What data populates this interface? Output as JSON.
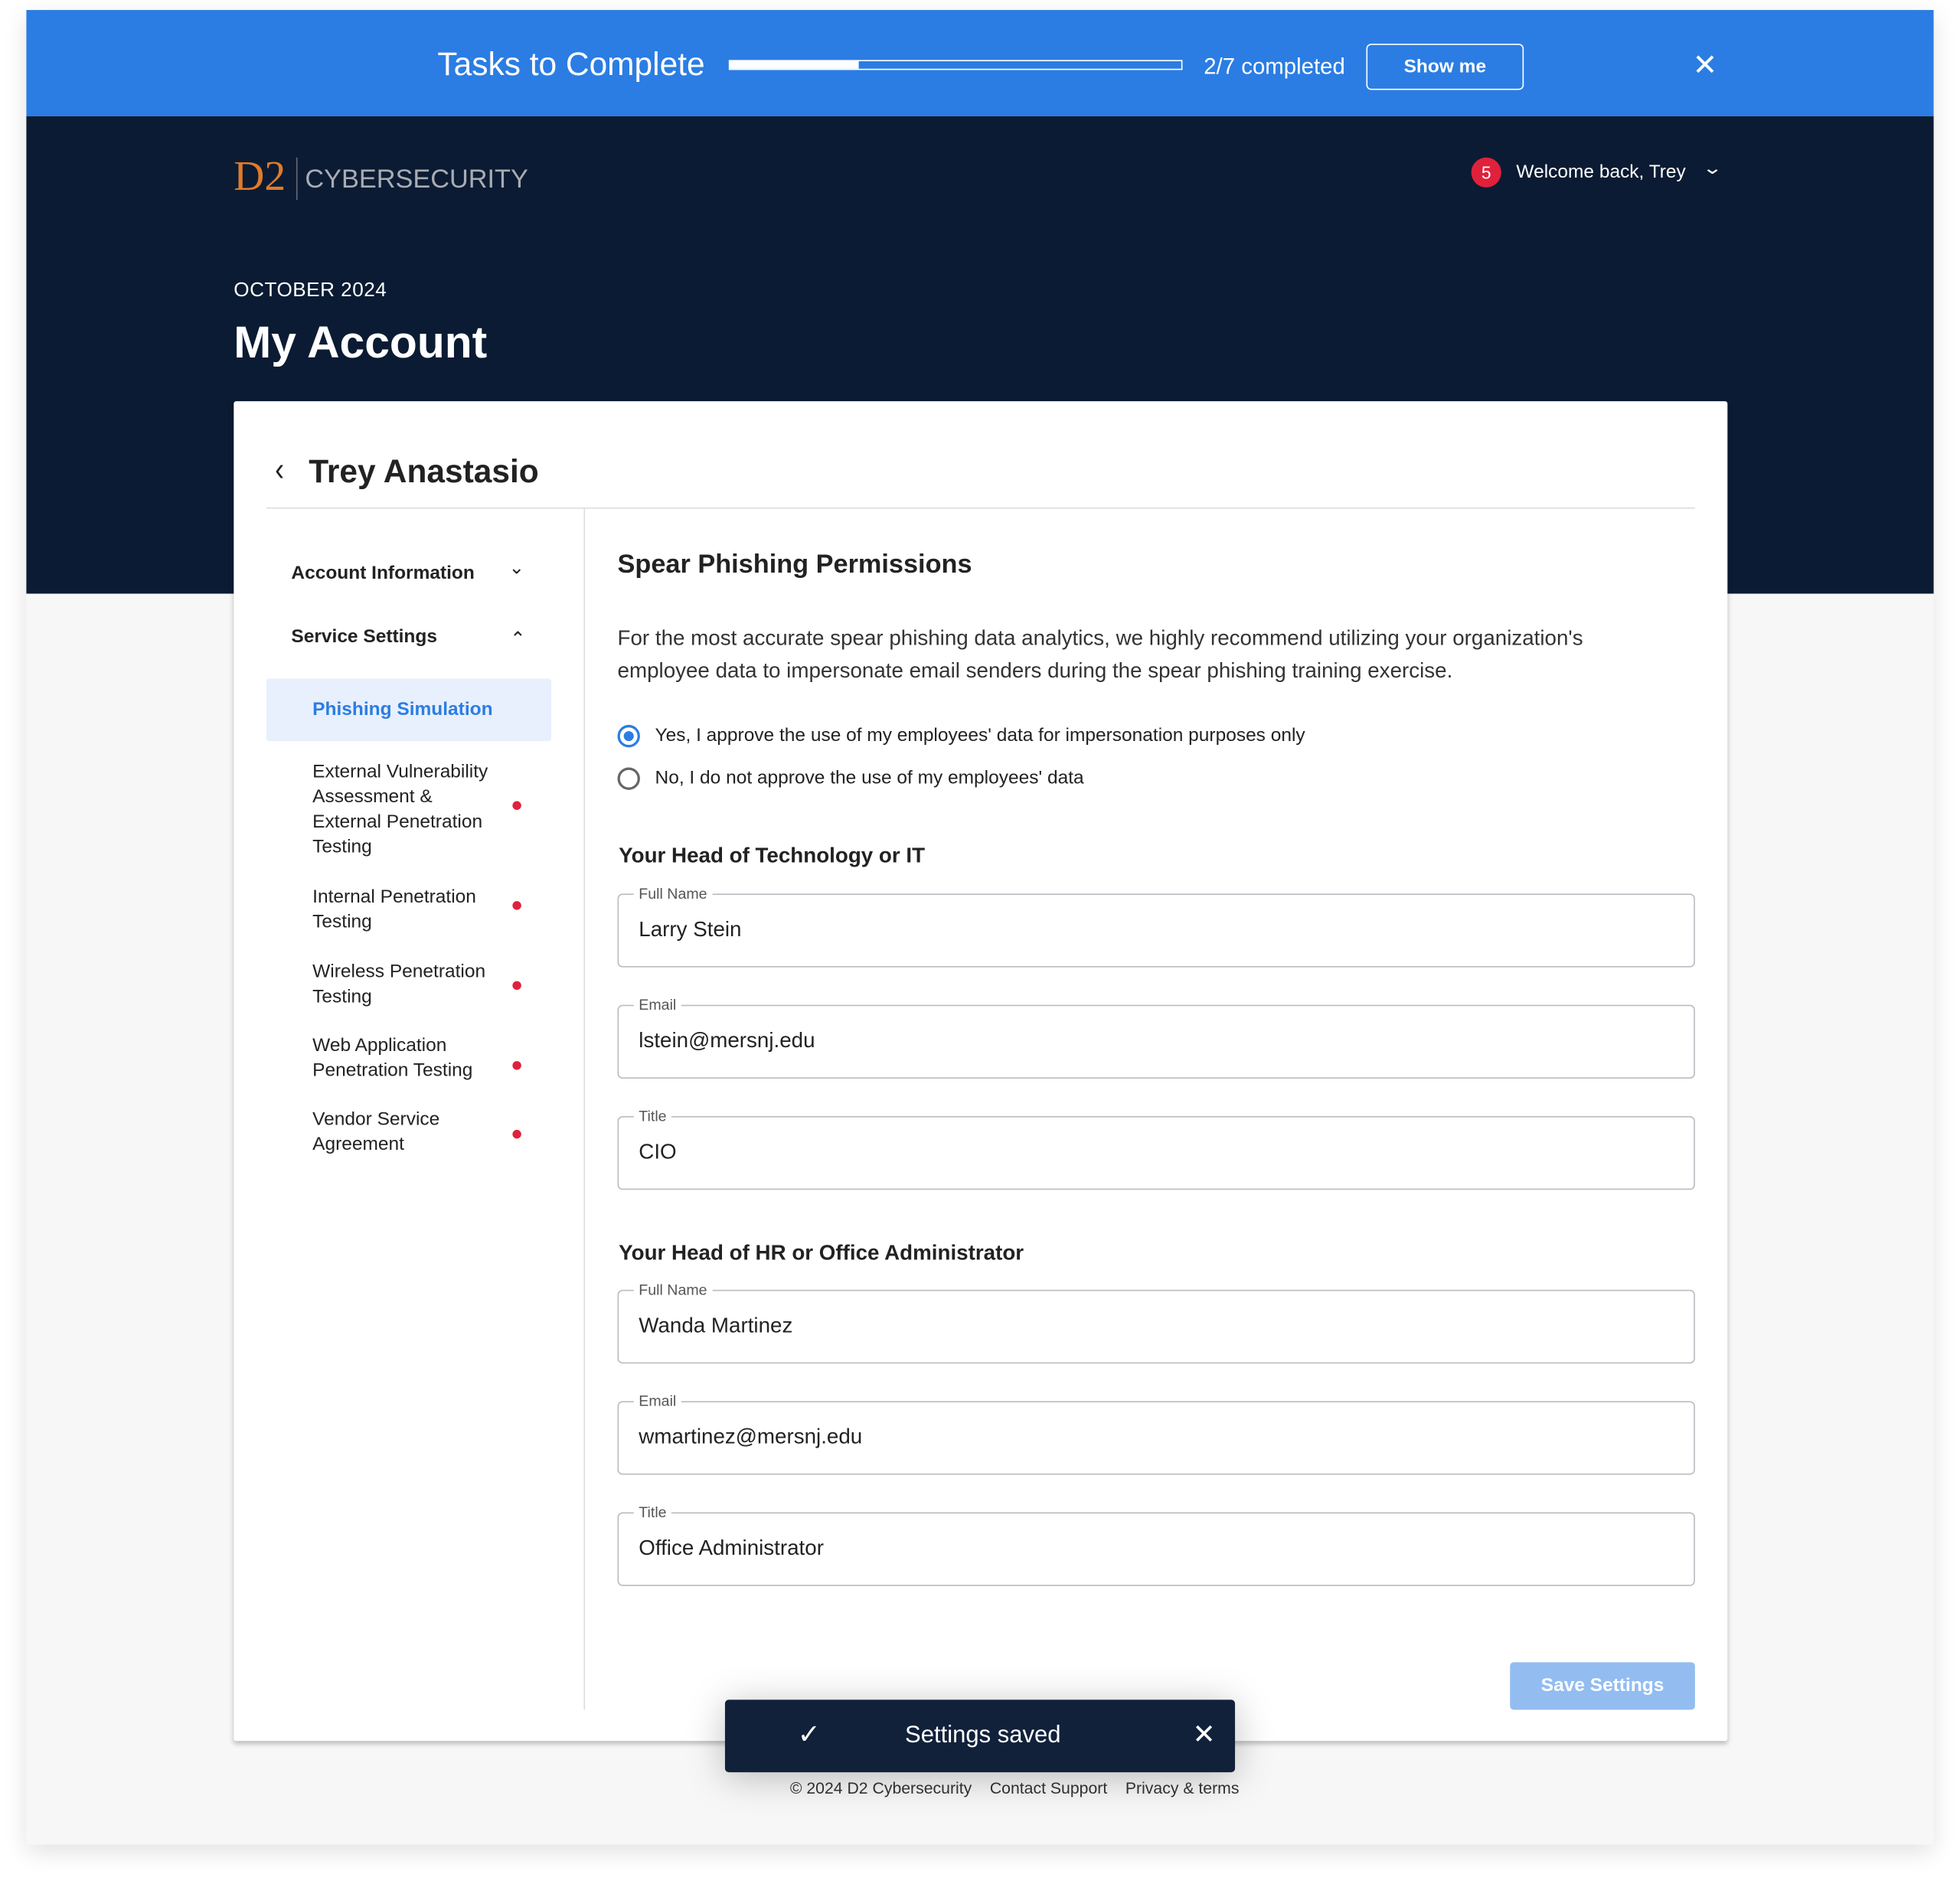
{
  "banner": {
    "title": "Tasks to Complete",
    "progress": {
      "completed": 2,
      "total": 7
    },
    "progress_text": "2/7 completed",
    "show_me": "Show me",
    "close_icon": "close-icon"
  },
  "header": {
    "logo_mark": "D2",
    "logo_text": "CYBERSECURITY",
    "notification_count": "5",
    "welcome": "Welcome back, Trey"
  },
  "page": {
    "date": "OCTOBER 2024",
    "title": "My Account"
  },
  "card": {
    "user_name": "Trey Anastasio"
  },
  "sidebar": {
    "account_information": "Account Information",
    "service_settings": "Service Settings",
    "items": [
      {
        "label": "Phishing Simulation",
        "active": true,
        "alert": false
      },
      {
        "label": "External Vulnerability Assessment & External Penetration Testing",
        "alert": true
      },
      {
        "label": "Internal Penetration Testing",
        "alert": true
      },
      {
        "label": "Wireless Penetration Testing",
        "alert": true
      },
      {
        "label": "Web Application Penetration Testing",
        "alert": true
      },
      {
        "label": "Vendor Service Agreement",
        "alert": true
      }
    ]
  },
  "main": {
    "title": "Spear Phishing Permissions",
    "description": "For the most accurate spear phishing data analytics, we highly recommend utilizing your organization's employee data to impersonate email senders during the spear phishing training exercise.",
    "options": [
      {
        "label": "Yes, I approve the use of my employees' data for impersonation purposes only",
        "selected": true
      },
      {
        "label": "No, I do not approve the use of my employees' data",
        "selected": false
      }
    ],
    "tech": {
      "heading": "Your Head of Technology or IT",
      "full_name_label": "Full Name",
      "full_name": "Larry Stein",
      "email_label": "Email",
      "email": "lstein@mersnj.edu",
      "title_label": "Title",
      "title": "CIO"
    },
    "hr": {
      "heading": "Your Head of HR or Office Administrator",
      "full_name_label": "Full Name",
      "full_name": "Wanda Martinez",
      "email_label": "Email",
      "email": "wmartinez@mersnj.edu",
      "title_label": "Title",
      "title": "Office Administrator"
    },
    "save": "Save Settings"
  },
  "toast": {
    "message": "Settings saved"
  },
  "footer": {
    "copyright": "© 2024 D2 Cybersecurity",
    "contact": "Contact Support",
    "privacy": "Privacy & terms"
  },
  "colors": {
    "accent": "#2b7de3",
    "navy": "#0b1b33",
    "alert": "#e0213b",
    "logo": "#e07b2a"
  }
}
